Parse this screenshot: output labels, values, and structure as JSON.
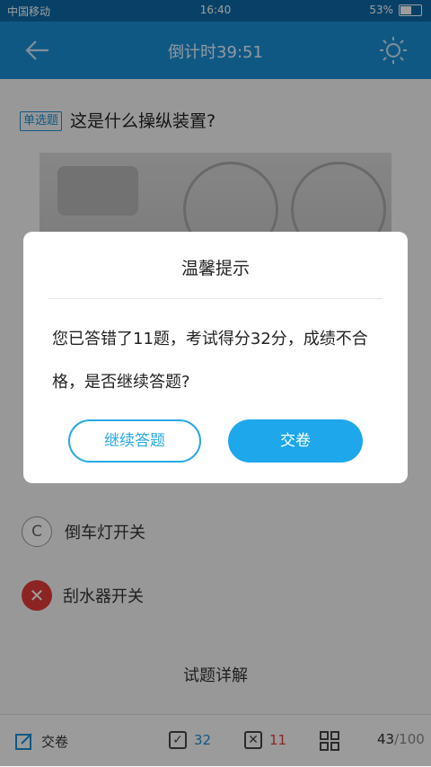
{
  "status_bar": {
    "carrier": "中国移动",
    "time": "16:40",
    "battery": "53%"
  },
  "header": {
    "title": "倒计时39:51"
  },
  "question": {
    "type_tag": "单选题",
    "text": "这是什么操纵装置?",
    "options": [
      {
        "letter": "C",
        "label": "倒车灯开关"
      },
      {
        "letter": "✕",
        "label": "刮水器开关"
      }
    ]
  },
  "detail_link": "试题详解",
  "bottom_bar": {
    "submit_label": "交卷",
    "correct_count": "32",
    "wrong_count": "11",
    "progress_current": "43",
    "progress_total": "/100"
  },
  "dialog": {
    "title": "温馨提示",
    "message": "您已答错了11题，考试得分32分，成绩不合格，是否继续答题?",
    "continue_label": "继续答题",
    "submit_label": "交卷"
  },
  "colors": {
    "primary": "#1b8fd6",
    "accent": "#1ea7ea",
    "wrong": "#e23b3b",
    "correct_text": "#1b8fd6",
    "wrong_text": "#e23b3b"
  }
}
